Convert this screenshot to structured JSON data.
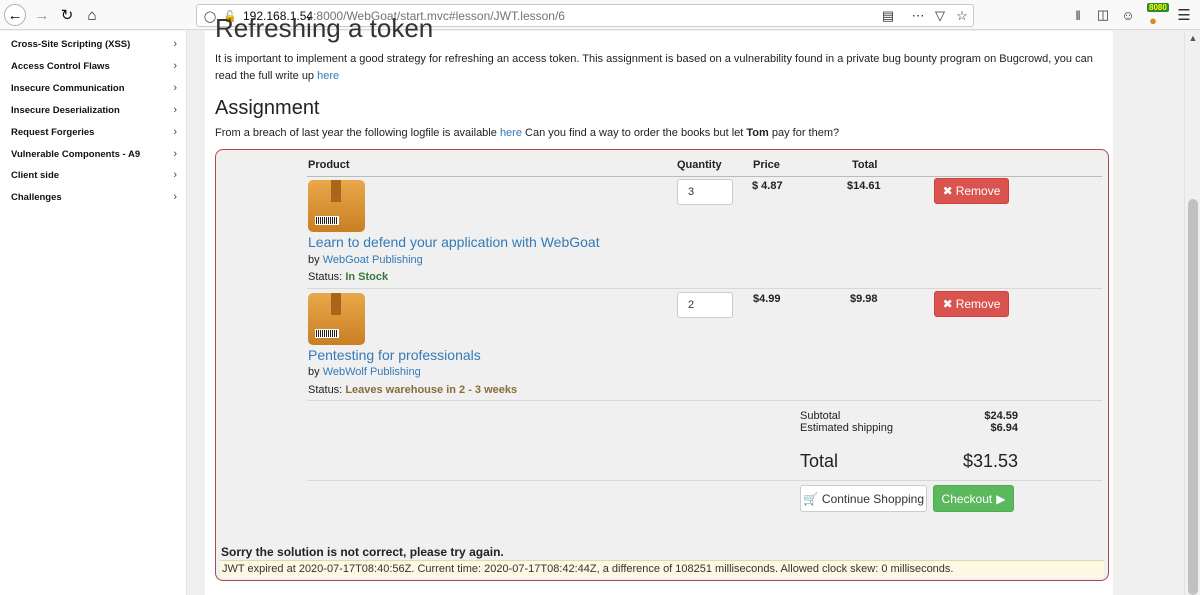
{
  "browser": {
    "url_host": "192.168.1.54",
    "url_rest": ":8000/WebGoat/start.mvc#lesson/JWT.lesson/6",
    "badge": "8080"
  },
  "sidebar": {
    "items": [
      {
        "label": "Cross-Site Scripting (XSS)"
      },
      {
        "label": "Access Control Flaws"
      },
      {
        "label": "Insecure Communication"
      },
      {
        "label": "Insecure Deserialization"
      },
      {
        "label": "Request Forgeries"
      },
      {
        "label": "Vulnerable Components - A9"
      },
      {
        "label": "Client side"
      },
      {
        "label": "Challenges"
      }
    ]
  },
  "lesson": {
    "title": "Refreshing a token",
    "intro": "It is important to implement a good strategy for refreshing an access token. This assignment is based on a vulnerability found in a private bug bounty program on Bugcrowd, you can read the full write up",
    "intro_link": "here",
    "assignment_heading": "Assignment",
    "assignment_pre": "From a breach of last year the following logfile is available",
    "assignment_link": "here",
    "assignment_mid": "Can you find a way to order the books but let",
    "assignment_bold": "Tom",
    "assignment_post": "pay for them?"
  },
  "cart": {
    "headers": {
      "product": "Product",
      "quantity": "Quantity",
      "price": "Price",
      "total": "Total"
    },
    "items": [
      {
        "name": "Learn to defend your application with WebGoat",
        "by": "by",
        "publisher": "WebGoat Publishing",
        "status_label": "Status:",
        "status": "In Stock",
        "quantity": "3",
        "price": "$ 4.87",
        "total": "$14.61",
        "remove": "Remove"
      },
      {
        "name": "Pentesting for professionals",
        "by": "by",
        "publisher": "WebWolf Publishing",
        "status_label": "Status:",
        "status": "Leaves warehouse in 2 - 3 weeks",
        "quantity": "2",
        "price": "$4.99",
        "total": "$9.98",
        "remove": "Remove"
      }
    ],
    "subtotal_label": "Subtotal",
    "subtotal": "$24.59",
    "shipping_label": "Estimated shipping",
    "shipping": "$6.94",
    "total_label": "Total",
    "total": "$31.53",
    "continue_label": "Continue Shopping",
    "checkout_label": "Checkout"
  },
  "feedback": "Sorry the solution is not correct, please try again.",
  "output": "JWT expired at 2020-07-17T08:40:56Z. Current time: 2020-07-17T08:42:44Z, a difference of 108251 milliseconds. Allowed clock skew: 0 milliseconds."
}
